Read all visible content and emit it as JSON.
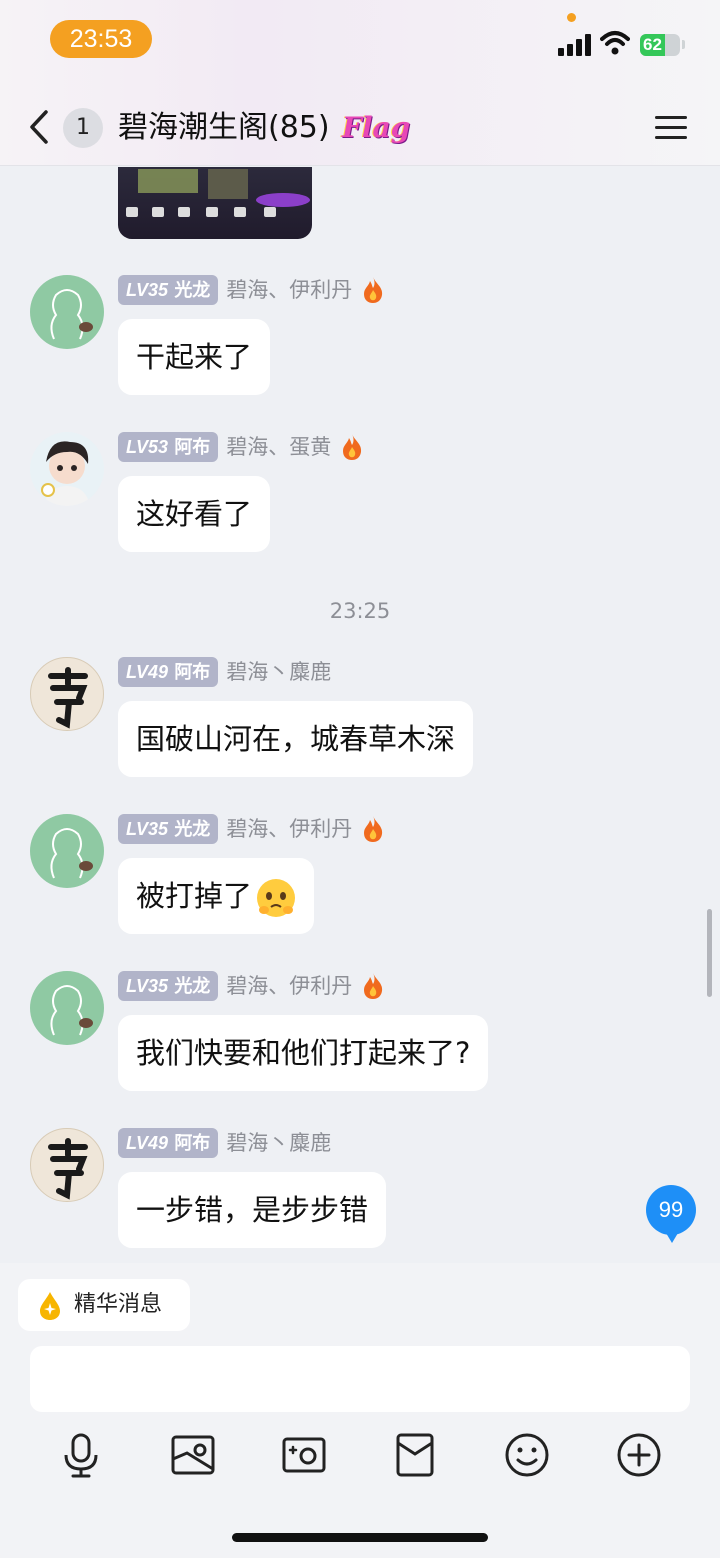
{
  "status_bar": {
    "time": "23:53",
    "battery": "62",
    "battery_level": 0.62,
    "accent_color": "#f4a021"
  },
  "header": {
    "unread_count": "1",
    "title": "碧海潮生阁(85)",
    "badge_text": "Flag"
  },
  "messages": [
    {
      "level": "LV35",
      "title": "光龙",
      "nickname": "碧海、伊利丹",
      "text": "干起来了",
      "avatar": "green-placeholder",
      "fire": true
    },
    {
      "level": "LV53",
      "title": "阿布",
      "nickname": "碧海、蛋黄",
      "text": "这好看了",
      "avatar": "anime-boy",
      "fire": true
    },
    {
      "level": "LV49",
      "title": "阿布",
      "nickname": "碧海丶麋鹿",
      "text": "国破山河在，城春草木深",
      "avatar": "ink-character",
      "fire": false
    },
    {
      "level": "LV35",
      "title": "光龙",
      "nickname": "碧海、伊利丹",
      "text": "被打掉了",
      "avatar": "green-placeholder",
      "fire": true,
      "emoji": "pleading-face"
    },
    {
      "level": "LV35",
      "title": "光龙",
      "nickname": "碧海、伊利丹",
      "text": "我们快要和他们打起来了?",
      "avatar": "green-placeholder",
      "fire": true
    },
    {
      "level": "LV49",
      "title": "阿布",
      "nickname": "碧海丶麋鹿",
      "text": "一步错，是步步错",
      "avatar": "ink-character",
      "fire": false
    }
  ],
  "timestamp": "23:25",
  "new_message_badge": "99",
  "essence_label": "精华消息",
  "input_placeholder": "",
  "toolbar": [
    "mic-icon",
    "photo-icon",
    "camera-icon",
    "red-packet-icon",
    "emoji-icon",
    "plus-icon"
  ],
  "colors": {
    "level_badge": "#b1b4c9",
    "fire": "#f06a1e",
    "badge_blue": "#1e8ff7"
  }
}
